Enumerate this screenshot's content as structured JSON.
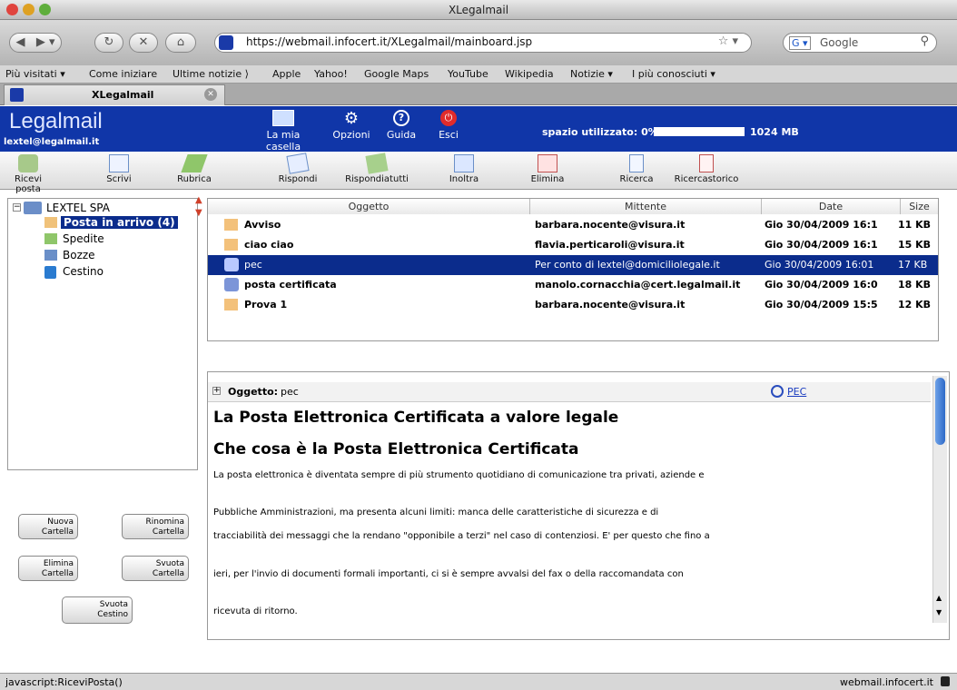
{
  "window": {
    "title": "XLegalmail"
  },
  "nav": {
    "url": "https://webmail.infocert.it/XLegalmail/mainboard.jsp",
    "search_engine": "Google"
  },
  "bookmarks": [
    "Più visitati ▾",
    "Come iniziare",
    "Ultime notizie ⟩",
    "Apple",
    "Yahoo!",
    "Google Maps",
    "YouTube",
    "Wikipedia",
    "Notizie ▾",
    "I più conosciuti ▾"
  ],
  "tab": {
    "label": "XLegalmail"
  },
  "app": {
    "logo": "Legalmail",
    "user": "lextel@legalmail.it",
    "nav": {
      "mailbox": "La mia casella",
      "options": "Opzioni",
      "help": "Guida",
      "exit": "Esci"
    },
    "space": {
      "label": "spazio utilizzato: 0%",
      "total": "1024 MB",
      "used_fraction": 0
    }
  },
  "toolbar": [
    "Ricevi posta",
    "Scrivi",
    "Rubrica",
    "Rispondi",
    "Rispondiatutti",
    "Inoltra",
    "Elimina",
    "Ricerca",
    "Ricercastorico"
  ],
  "folders": {
    "root": "LEXTEL SPA",
    "items": [
      "Posta in arrivo (4)",
      "Spedite",
      "Bozze",
      "Cestino"
    ],
    "buttons": {
      "new": [
        "Nuova",
        "Cartella"
      ],
      "rename": [
        "Rinomina",
        "Cartella"
      ],
      "delete": [
        "Elimina",
        "Cartella"
      ],
      "empty": [
        "Svuota",
        "Cartella"
      ],
      "empty_trash": [
        "Svuota",
        "Cestino"
      ]
    }
  },
  "messages": {
    "columns": {
      "subject": "Oggetto",
      "sender": "Mittente",
      "date": "Date",
      "size": "Size"
    },
    "rows": [
      {
        "subject": "Avviso",
        "sender": "barbara.nocente@visura.it",
        "date": "Gio 30/04/2009 16:1",
        "size": "11 KB"
      },
      {
        "subject": "ciao ciao",
        "sender": "flavia.perticaroli@visura.it",
        "date": "Gio 30/04/2009 16:1",
        "size": "15 KB"
      },
      {
        "subject": "pec",
        "sender": "Per conto di lextel@domiciliolegale.it",
        "date": "Gio 30/04/2009 16:01",
        "size": "17 KB"
      },
      {
        "subject": "posta certificata",
        "sender": "manolo.cornacchia@cert.legalmail.it",
        "date": "Gio 30/04/2009 16:0",
        "size": "18 KB"
      },
      {
        "subject": "Prova 1",
        "sender": "barbara.nocente@visura.it",
        "date": "Gio 30/04/2009 15:5",
        "size": "12 KB"
      }
    ]
  },
  "preview": {
    "subject_label": "Oggetto:",
    "subject": "pec",
    "pec_link": "PEC",
    "h1": "La Posta Elettronica Certificata a valore legale",
    "h2": "Che cosa è la Posta Elettronica Certificata",
    "paragraphs": [
      "La posta elettronica è diventata sempre di più strumento quotidiano di comunicazione tra privati, aziende e",
      "Pubbliche Amministrazioni, ma presenta alcuni limiti: manca delle caratteristiche di sicurezza e di",
      "tracciabilità dei messaggi che la rendano \"opponibile a terzi\" nel caso di contenziosi. E' per questo che fino a",
      "ieri, per l'invio di documenti formali importanti, ci si è sempre avvalsi del fax o della raccomandata con",
      "ricevuta di ritorno."
    ]
  },
  "status": {
    "left": "javascript:RiceviPosta()",
    "right": "webmail.infocert.it"
  }
}
